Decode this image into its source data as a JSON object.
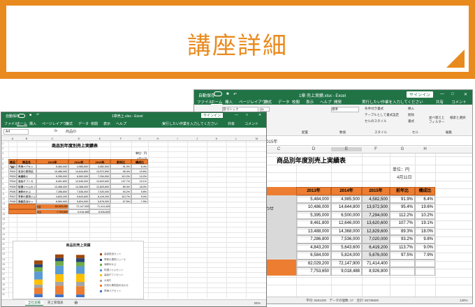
{
  "banner": {
    "title": "講座詳細"
  },
  "back": {
    "title": "1章 売上実績.xlsx - Excel",
    "autosave": "自動保存",
    "signin": "サインイン",
    "tabs": [
      "ファイル",
      "ホーム",
      "挿入",
      "ページレイアウト",
      "数式",
      "データ",
      "校閲",
      "表示",
      "ヘルプ",
      "開発"
    ],
    "tellme": "実行したい作業を入力してください",
    "share": "共有",
    "comment": "コメント",
    "ribbon": {
      "font": "游ゴシック",
      "size": "11",
      "format": "標準",
      "cond": "条件付き書式",
      "tablefmt": "テーブルとして書式設定",
      "cellstyle": "セルのスタイル",
      "insert": "挿入",
      "delete": "削除",
      "fmt": "書式",
      "sortfilter": "並べ替えとフィルター",
      "find": "検索と選択",
      "g_clip": "クリップボード",
      "g_font": "フォント",
      "g_align": "配置",
      "g_num": "数値",
      "g_style": "スタイル",
      "g_cell": "セル",
      "g_edit": "編集"
    },
    "formula": "2015年",
    "cols": [
      "C",
      "D",
      "E",
      "F",
      "G",
      "H"
    ],
    "sheet_title": "商品別年度別売上実績表",
    "unit": "単位：円",
    "date": "4月11日",
    "headers": [
      "2013年",
      "2014年",
      "2015年",
      "前年比",
      "構成比"
    ],
    "rowlabel": "わせ",
    "rows": [
      [
        "5,484,000",
        "4,985,500",
        "4,582,500",
        "91.9%",
        "6.4%"
      ],
      [
        "10,486,000",
        "14,644,800",
        "13,972,500",
        "95.4%",
        "19.6%"
      ],
      [
        "5,395,000",
        "6,500,000",
        "7,294,000",
        "112.2%",
        "10.2%"
      ],
      [
        "8,461,800",
        "12,646,000",
        "13,620,600",
        "107.7%",
        "19.1%"
      ],
      [
        "13,488,000",
        "14,368,000",
        "12,829,600",
        "89.3%",
        "18.0%"
      ],
      [
        "7,286,800",
        "7,536,000",
        "7,020,000",
        "93.2%",
        "9.8%"
      ],
      [
        "4,843,200",
        "5,643,600",
        "6,419,200",
        "113.7%",
        "9.0%"
      ],
      [
        "6,584,000",
        "5,824,000",
        "5,676,000",
        "97.5%",
        "7.9%"
      ],
      [
        "62,029,200",
        "72,147,900",
        "71,414,400",
        "",
        ""
      ],
      [
        "7,753,650",
        "9,018,488",
        "8,926,800",
        "",
        ""
      ]
    ],
    "status": "平均: 9281200　データの個数: 17　合計: 65735600",
    "zoom": "130%"
  },
  "front": {
    "title": "1章売上.xlsx - Excel",
    "autosave": "自動保存",
    "signin": "サインイン",
    "tabs": [
      "ファイル",
      "ホーム",
      "挿入",
      "ページレイアウト",
      "数式",
      "データ",
      "校閲",
      "表示",
      "ヘルプ"
    ],
    "tellme": "実行したい作業を入力してください",
    "share": "共有",
    "comment": "コメント",
    "namebox": "A4",
    "formula": "商品ID",
    "cols": [
      "A",
      "B",
      "C",
      "D",
      "E",
      "F",
      "G",
      "H",
      "I",
      "J",
      "K",
      "L",
      "M"
    ],
    "sheet_title": "商品別年度別売上実績表",
    "unit": "単位：円",
    "date": "4月11日",
    "headers": [
      "商品ID",
      "商品名",
      "2013年",
      "2014年",
      "2015年",
      "前年比",
      "構成比"
    ],
    "rows": [
      [
        "P001",
        "青梅ペアセット",
        "5,484,000",
        "4,985,500",
        "4,582,500",
        "91.9%",
        "6.4%"
      ],
      [
        "P002",
        "天然の果物詰め合わせ",
        "10,486,000",
        "14,644,800",
        "13,972,500",
        "95.4%",
        "19.6%"
      ],
      [
        "P003",
        "大地牛",
        "5,395,000",
        "6,500,000",
        "7,294,000",
        "112.2%",
        "10.2%"
      ],
      [
        "P004",
        "高級ギフトセット",
        "8,461,800",
        "12,646,000",
        "13,620,600",
        "107.7%",
        "19.1%"
      ],
      [
        "P005",
        "特選ジャムセット",
        "13,488,000",
        "14,368,000",
        "12,829,600",
        "89.3%",
        "18.0%"
      ],
      [
        "P006",
        "海鮮めかぶ",
        "7,286,800",
        "7,536,000",
        "7,020,000",
        "93.2%",
        "9.8%"
      ],
      [
        "P007",
        "季節の果物ジュース",
        "4,843,200",
        "5,643,600",
        "6,419,200",
        "113.7%",
        "9.0%"
      ],
      [
        "P008",
        "高級醤油セット",
        "6,584,000",
        "5,824,000",
        "5,676,000",
        "97.5%",
        "7.9%"
      ]
    ],
    "total_label": "合計",
    "total": [
      "62,029,200",
      "72,147,900",
      "71,414,400"
    ],
    "avg_label": "平均",
    "avg": [
      "7,753,650",
      "9,018,488",
      "8,926,800"
    ],
    "chart_title": "商品別売上実績",
    "legend": [
      "高級醤油セット",
      "季節の果物ジュース",
      "海鮮めかぶ",
      "特選ジャムセット",
      "高級ギフトセット",
      "大地牛",
      "天然の果物詰め合わせ",
      "青梅ペアセット"
    ],
    "sheet_tabs": [
      "全社実績",
      "売上管理表"
    ],
    "zoom": "85%"
  },
  "chart_data": {
    "type": "bar",
    "title": "商品別売上実績",
    "categories": [
      "2013年",
      "2014年",
      "2015年"
    ],
    "series": [
      {
        "name": "青梅ペアセット",
        "values": [
          5484000,
          4985500,
          4582500
        ]
      },
      {
        "name": "天然の果物詰め合わせ",
        "values": [
          10486000,
          14644800,
          13972500
        ]
      },
      {
        "name": "大地牛",
        "values": [
          5395000,
          6500000,
          7294000
        ]
      },
      {
        "name": "高級ギフトセット",
        "values": [
          8461800,
          12646000,
          13620600
        ]
      },
      {
        "name": "特選ジャムセット",
        "values": [
          13488000,
          14368000,
          12829600
        ]
      },
      {
        "name": "海鮮めかぶ",
        "values": [
          7286800,
          7536000,
          7020000
        ]
      },
      {
        "name": "季節の果物ジュース",
        "values": [
          4843200,
          5643600,
          6419200
        ]
      },
      {
        "name": "高級醤油セット",
        "values": [
          6584000,
          5824000,
          5676000
        ]
      }
    ],
    "stacked": true,
    "legend": "right"
  }
}
